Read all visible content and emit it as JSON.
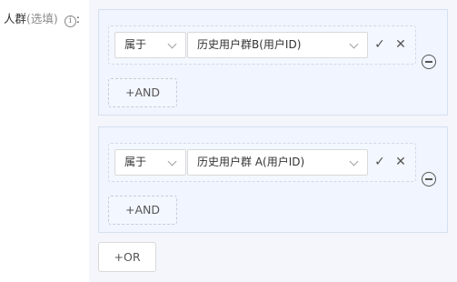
{
  "field": {
    "label": "人群",
    "optional_text": "(选填)",
    "info_icon": "i",
    "colon": ":"
  },
  "groups": [
    {
      "condition": {
        "operator": "属于",
        "value": "历史用户群B(用户ID)"
      },
      "confirm_icon": "✓",
      "cancel_icon": "✕",
      "add_and_label": "+AND"
    },
    {
      "condition": {
        "operator": "属于",
        "value": "历史用户群 A(用户ID)"
      },
      "confirm_icon": "✓",
      "cancel_icon": "✕",
      "add_and_label": "+AND"
    }
  ],
  "add_or_label": "+OR",
  "colors": {
    "group_background": "#f0f5ff",
    "panel_background": "#f4f6fb",
    "border": "#d9d9d9"
  }
}
